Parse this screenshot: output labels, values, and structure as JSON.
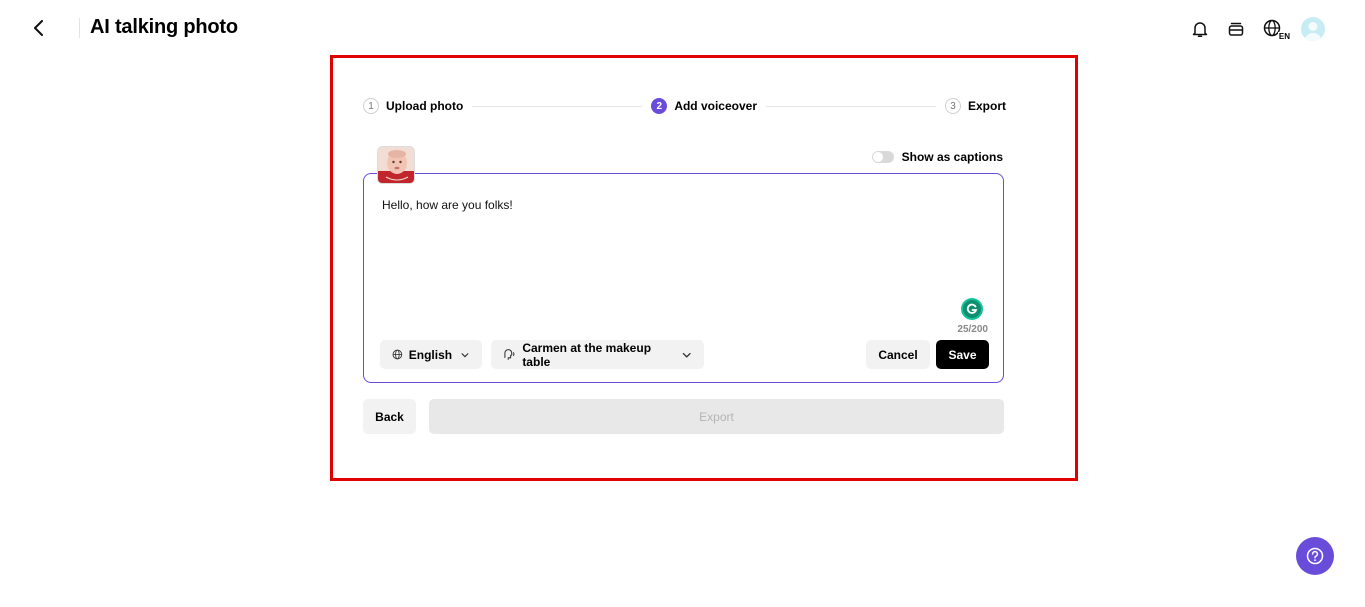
{
  "header": {
    "title": "AI talking photo",
    "language_badge": "EN",
    "icons": [
      "back-chevron-icon",
      "bell-icon",
      "credits-icon",
      "globe-icon",
      "avatar"
    ]
  },
  "stepper": {
    "steps": [
      {
        "num": "1",
        "label": "Upload photo",
        "state": "done"
      },
      {
        "num": "2",
        "label": "Add voiceover",
        "state": "active"
      },
      {
        "num": "3",
        "label": "Export",
        "state": "pending"
      }
    ]
  },
  "captions": {
    "label": "Show as captions",
    "enabled": false
  },
  "editor": {
    "text": "Hello, how are you folks!",
    "char_count": "25/200"
  },
  "controls": {
    "language": "English",
    "voice": "Carmen at the makeup table",
    "cancel_label": "Cancel",
    "save_label": "Save"
  },
  "footer": {
    "back_label": "Back",
    "export_label": "Export"
  },
  "colors": {
    "accent": "#6a4cdb",
    "highlight_border": "#e00000",
    "grammarly": "#15c39a"
  }
}
